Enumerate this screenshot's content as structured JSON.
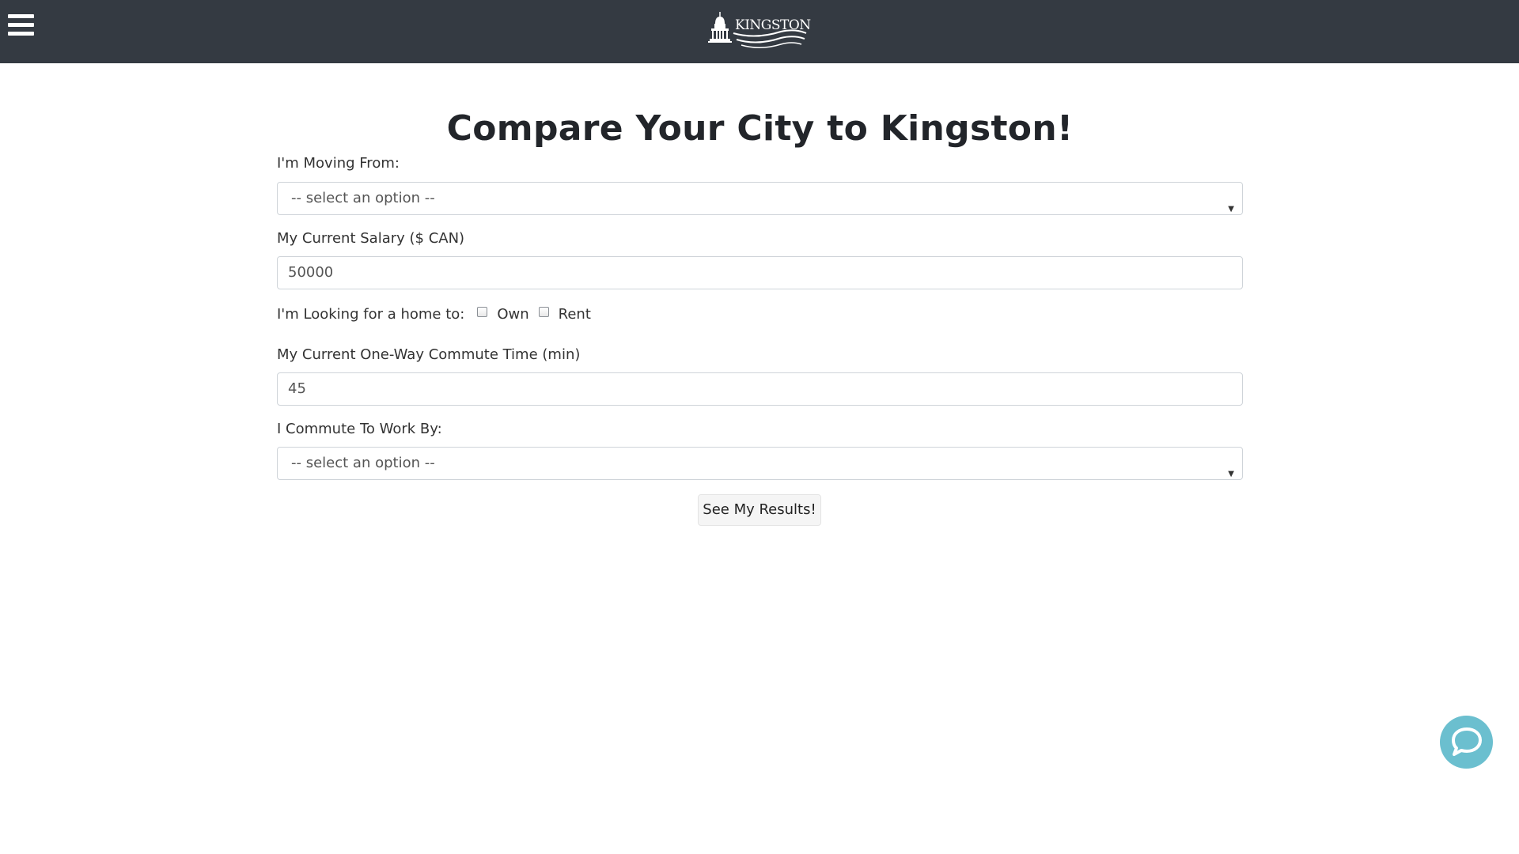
{
  "header": {
    "logo_text": "KINGSTON",
    "menu_icon": "hamburger-menu-icon",
    "background_color": "#343a42"
  },
  "main": {
    "title": "Compare Your City to Kingston!",
    "moving_from": {
      "label": "I'm Moving From:",
      "selected": "-- select an option --"
    },
    "salary": {
      "label": "My Current Salary ($ CAN)",
      "value": "50000"
    },
    "home": {
      "label": "I'm Looking for a home to:",
      "options": [
        {
          "label": "Own",
          "checked": false
        },
        {
          "label": "Rent",
          "checked": false
        }
      ]
    },
    "commute_time": {
      "label": "My Current One-Way Commute Time (min)",
      "value": "45"
    },
    "commute_mode": {
      "label": "I Commute To Work By:",
      "selected": "-- select an option --"
    },
    "submit_label": "See My Results!"
  },
  "chat": {
    "icon": "chat-bubble-icon",
    "color": "#6bbfcf"
  }
}
